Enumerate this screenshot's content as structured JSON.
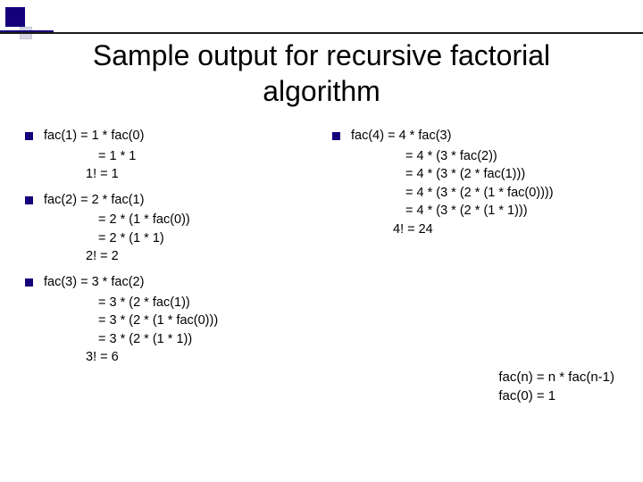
{
  "title": "Sample output for recursive factorial algorithm",
  "left": {
    "g1": {
      "head": "fac(1) = 1 * fac(0)",
      "l1": "= 1 * 1",
      "l2": "1! = 1"
    },
    "g2": {
      "head": "fac(2) = 2 * fac(1)",
      "l1": "= 2 * (1 * fac(0))",
      "l2": "= 2 * (1 * 1)",
      "l3": "2! = 2"
    },
    "g3": {
      "head": "fac(3) = 3 * fac(2)",
      "l1": "= 3 * (2 * fac(1))",
      "l2": "= 3 * (2 * (1 * fac(0)))",
      "l3": "= 3 * (2 * (1 * 1))",
      "l4": "3! = 6"
    }
  },
  "right": {
    "g4": {
      "head": "fac(4) = 4 * fac(3)",
      "l1": "= 4 * (3 * fac(2))",
      "l2": "= 4 * (3 * (2 * fac(1)))",
      "l3": "= 4 * (3 * (2 * (1 * fac(0))))",
      "l4": "= 4 * (3 * (2 * (1 * 1)))",
      "l5": "4!  = 24"
    }
  },
  "formula": {
    "l1": "fac(n) = n *  fac(n-1)",
    "l2": "fac(0) = 1"
  }
}
